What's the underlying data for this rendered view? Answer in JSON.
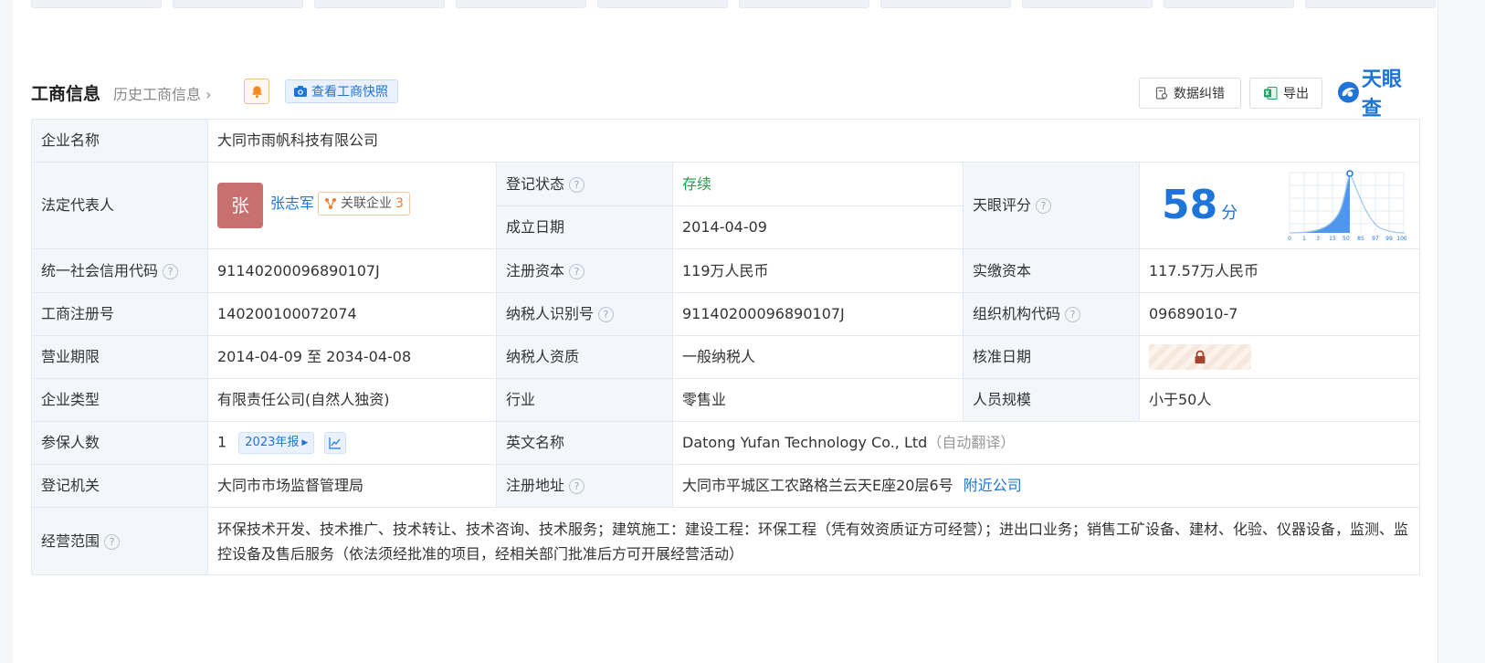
{
  "header": {
    "title": "工商信息",
    "history_link": "历史工商信息",
    "snapshot_label": "查看工商快照",
    "correct_label": "数据纠错",
    "export_label": "导出",
    "logo_text": "天眼查",
    "accent_color": "#1e74d9"
  },
  "rows": {
    "company_name": {
      "label": "企业名称",
      "value": "大同市雨帆科技有限公司"
    },
    "legal_rep": {
      "label": "法定代表人",
      "avatar_char": "张",
      "name": "张志军",
      "related_label": "关联企业",
      "related_count": "3"
    },
    "reg_status": {
      "label": "登记状态",
      "value": "存续"
    },
    "founded": {
      "label": "成立日期",
      "value": "2014-04-09"
    },
    "score": {
      "label": "天眼评分",
      "value": "58",
      "unit": "分",
      "axis_ticks": [
        "0",
        "1",
        "3",
        "15",
        "50",
        "85",
        "97",
        "99",
        "100"
      ]
    },
    "credit_code": {
      "label": "统一社会信用代码",
      "value": "91140200096890107J"
    },
    "reg_capital": {
      "label": "注册资本",
      "value": "119万人民币"
    },
    "paid_capital": {
      "label": "实缴资本",
      "value": "117.57万人民币"
    },
    "reg_number": {
      "label": "工商注册号",
      "value": "140200100072074"
    },
    "taxpayer_id": {
      "label": "纳税人识别号",
      "value": "91140200096890107J"
    },
    "org_code": {
      "label": "组织机构代码",
      "value": "09689010-7"
    },
    "term": {
      "label": "营业期限",
      "value": "2014-04-09 至 2034-04-08"
    },
    "taxpayer_qual": {
      "label": "纳税人资质",
      "value": "一般纳税人"
    },
    "approval_date": {
      "label": "核准日期"
    },
    "company_type": {
      "label": "企业类型",
      "value": "有限责任公司(自然人独资)"
    },
    "industry": {
      "label": "行业",
      "value": "零售业"
    },
    "staff_size": {
      "label": "人员规模",
      "value": "小于50人"
    },
    "insured": {
      "label": "参保人数",
      "value": "1",
      "report": "2023年报"
    },
    "english_name": {
      "label": "英文名称",
      "value": "Datong Yufan Technology Co., Ltd",
      "note": "（自动翻译）"
    },
    "authority": {
      "label": "登记机关",
      "value": "大同市市场监督管理局"
    },
    "address": {
      "label": "注册地址",
      "value": "大同市平城区工农路格兰云天E座20层6号",
      "nearby": "附近公司"
    },
    "scope": {
      "label": "经营范围",
      "value": "环保技术开发、技术推广、技术转让、技术咨询、技术服务；建筑施工：建设工程：环保工程（凭有效资质证方可经营）；进出口业务；销售工矿设备、建材、化验、仪器设备，监测、监控设备及售后服务（依法须经批准的项目，经相关部门批准后方可开展经营活动）"
    }
  }
}
